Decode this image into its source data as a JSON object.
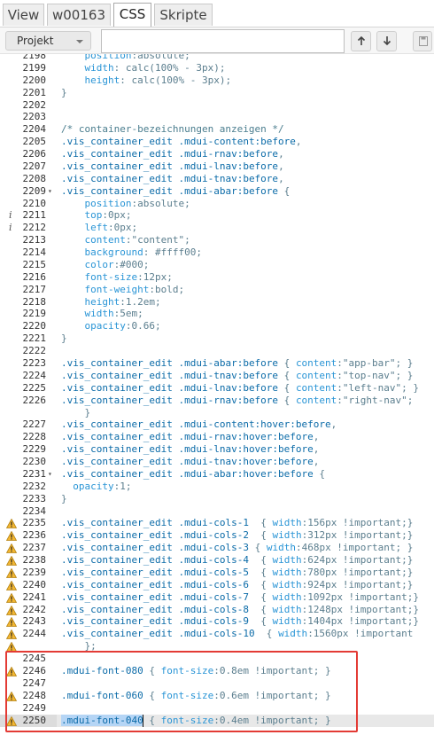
{
  "tabs": [
    "View",
    "w00163",
    "CSS",
    "Skripte"
  ],
  "active_tab": "CSS",
  "toolbar": {
    "project_select": "Projekt",
    "file_input_value": "",
    "up_icon": "arrow-up-icon",
    "down_icon": "arrow-down-icon",
    "save_icon": "save-icon"
  },
  "colors": {
    "selector": "#0b6ba8",
    "property": "#2a95d6",
    "warning": "#f2b632",
    "highlight_box": "#e33b35"
  },
  "editor": {
    "lines": [
      {
        "n": "2198",
        "text": "    position:absolute;"
      },
      {
        "n": "2199",
        "text": "    width: calc(100% - 3px);"
      },
      {
        "n": "2200",
        "text": "    height: calc(100% - 3px);"
      },
      {
        "n": "2201",
        "text": "}"
      },
      {
        "n": "2202",
        "text": ""
      },
      {
        "n": "2203",
        "text": ""
      },
      {
        "n": "2204",
        "text": "/* container-bezeichnungen anzeigen */"
      },
      {
        "n": "2205",
        "text": ".vis_container_edit .mdui-content:before,"
      },
      {
        "n": "2206",
        "text": ".vis_container_edit .mdui-rnav:before,"
      },
      {
        "n": "2207",
        "text": ".vis_container_edit .mdui-lnav:before,"
      },
      {
        "n": "2208",
        "text": ".vis_container_edit .mdui-tnav:before,"
      },
      {
        "n": "2209",
        "text": ".vis_container_edit .mdui-abar:before {",
        "fold": true
      },
      {
        "n": "2210",
        "text": "    position:absolute;"
      },
      {
        "n": "2211",
        "text": "    top:0px;",
        "info": true
      },
      {
        "n": "2212",
        "text": "    left:0px;",
        "info": true
      },
      {
        "n": "2213",
        "text": "    content:\"content\";"
      },
      {
        "n": "2214",
        "text": "    background: #ffff00;"
      },
      {
        "n": "2215",
        "text": "    color:#000;"
      },
      {
        "n": "2216",
        "text": "    font-size:12px;"
      },
      {
        "n": "2217",
        "text": "    font-weight:bold;"
      },
      {
        "n": "2218",
        "text": "    height:1.2em;"
      },
      {
        "n": "2219",
        "text": "    width:5em;"
      },
      {
        "n": "2220",
        "text": "    opacity:0.66;"
      },
      {
        "n": "2221",
        "text": "}"
      },
      {
        "n": "2222",
        "text": ""
      },
      {
        "n": "2223",
        "text": ".vis_container_edit .mdui-abar:before { content:\"app-bar\"; }"
      },
      {
        "n": "2224",
        "text": ".vis_container_edit .mdui-tnav:before { content:\"top-nav\"; }"
      },
      {
        "n": "2225",
        "text": ".vis_container_edit .mdui-lnav:before { content:\"left-nav\"; }"
      },
      {
        "n": "2226",
        "text": ".vis_container_edit .mdui-rnav:before { content:\"right-nav\";"
      },
      {
        "n": "",
        "text": "    }"
      },
      {
        "n": "2227",
        "text": ".vis_container_edit .mdui-content:hover:before,"
      },
      {
        "n": "2228",
        "text": ".vis_container_edit .mdui-rnav:hover:before,"
      },
      {
        "n": "2229",
        "text": ".vis_container_edit .mdui-lnav:hover:before,"
      },
      {
        "n": "2230",
        "text": ".vis_container_edit .mdui-tnav:hover:before,"
      },
      {
        "n": "2231",
        "text": ".vis_container_edit .mdui-abar:hover:before {",
        "fold": true
      },
      {
        "n": "2232",
        "text": "  opacity:1;"
      },
      {
        "n": "2233",
        "text": "}"
      },
      {
        "n": "2234",
        "text": ""
      },
      {
        "n": "2235",
        "text": ".vis_container_edit .mdui-cols-1  { width:156px !important;}",
        "warn": true
      },
      {
        "n": "2236",
        "text": ".vis_container_edit .mdui-cols-2  { width:312px !important;}",
        "warn": true
      },
      {
        "n": "2237",
        "text": ".vis_container_edit .mdui-cols-3 { width:468px !important; }",
        "warn": true
      },
      {
        "n": "2238",
        "text": ".vis_container_edit .mdui-cols-4  { width:624px !important;}",
        "warn": true
      },
      {
        "n": "2239",
        "text": ".vis_container_edit .mdui-cols-5  { width:780px !important;}",
        "warn": true
      },
      {
        "n": "2240",
        "text": ".vis_container_edit .mdui-cols-6  { width:924px !important;}",
        "warn": true
      },
      {
        "n": "2241",
        "text": ".vis_container_edit .mdui-cols-7  { width:1092px !important;}",
        "warn": true
      },
      {
        "n": "2242",
        "text": ".vis_container_edit .mdui-cols-8  { width:1248px !important;}",
        "warn": true
      },
      {
        "n": "2243",
        "text": ".vis_container_edit .mdui-cols-9  { width:1404px !important;}",
        "warn": true
      },
      {
        "n": "2244",
        "text": ".vis_container_edit .mdui-cols-10  { width:1560px !important",
        "warn": true
      },
      {
        "n": "",
        "text": "    };",
        "warn": true
      },
      {
        "n": "2245",
        "text": ""
      },
      {
        "n": "2246",
        "text": ".mdui-font-080 { font-size:0.8em !important; }",
        "warn": true
      },
      {
        "n": "2247",
        "text": ""
      },
      {
        "n": "2248",
        "text": ".mdui-font-060 { font-size:0.6em !important; }",
        "warn": true
      },
      {
        "n": "2249",
        "text": ""
      },
      {
        "n": "2250",
        "text": ".mdui-font-040 { font-size:0.4em !important; }",
        "warn": true,
        "current": true
      }
    ]
  }
}
